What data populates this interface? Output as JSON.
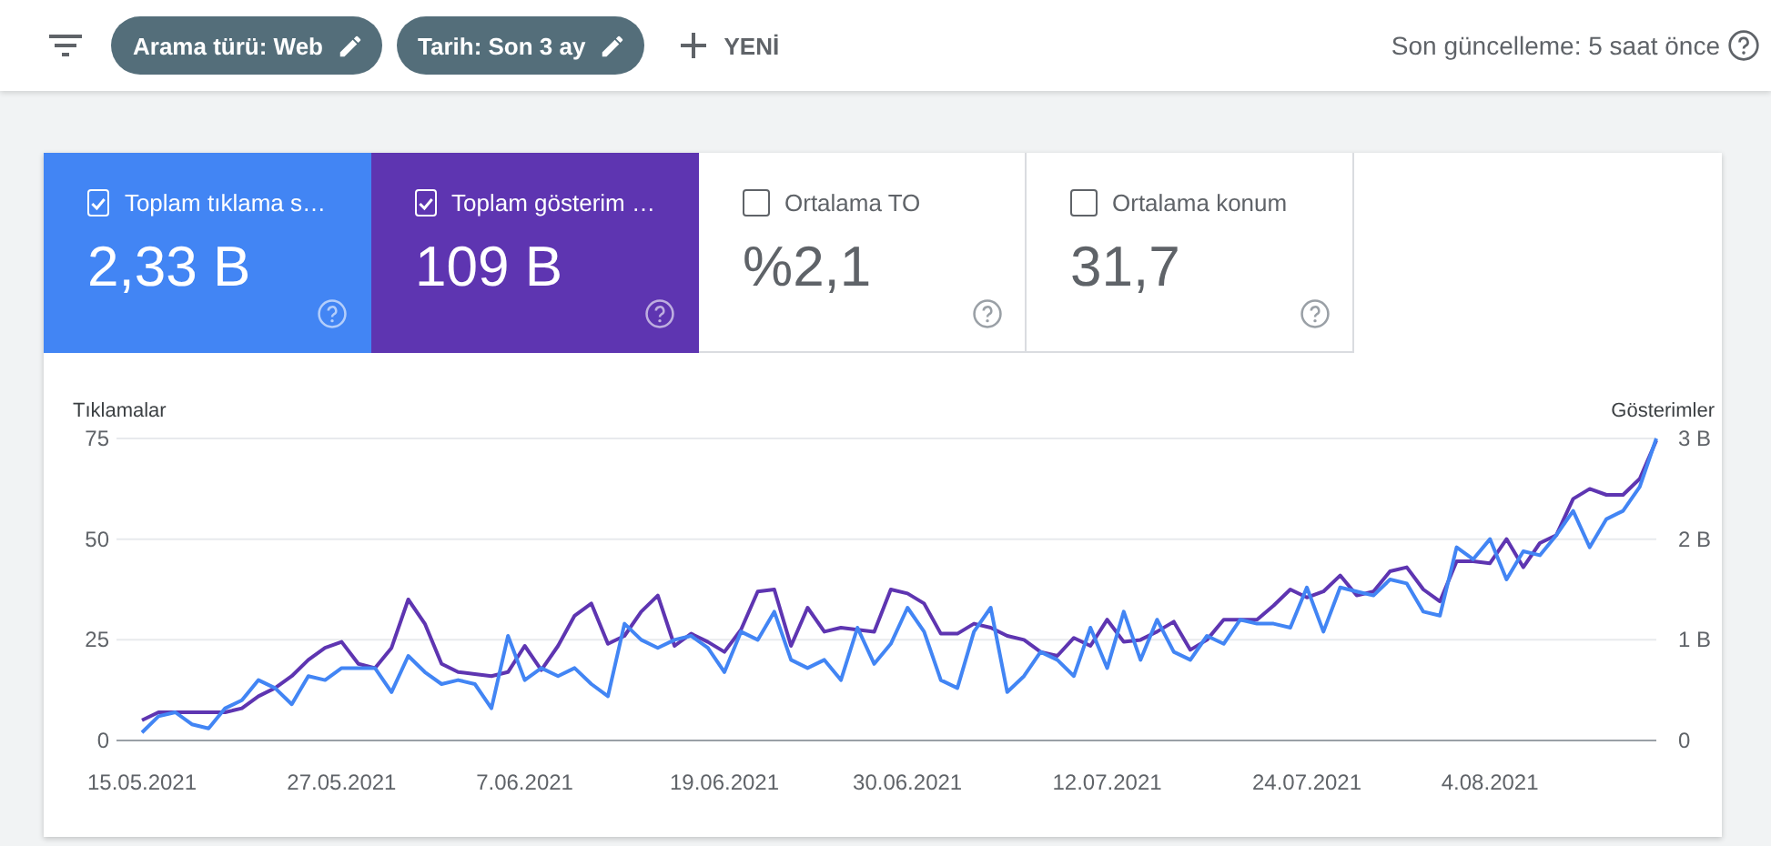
{
  "toolbar": {
    "chips": [
      {
        "label": "Arama türü: Web"
      },
      {
        "label": "Tarih: Son 3 ay"
      }
    ],
    "new_button": "YENİ",
    "last_update": "Son güncelleme: 5 saat önce"
  },
  "metrics": [
    {
      "title": "Toplam tıklama s…",
      "value": "2,33 B",
      "selected": true,
      "color": "#4285f4"
    },
    {
      "title": "Toplam gösterim …",
      "value": "109 B",
      "selected": true,
      "color": "#5e35b1"
    },
    {
      "title": "Ortalama TO",
      "value": "%2,1",
      "selected": false
    },
    {
      "title": "Ortalama konum",
      "value": "31,7",
      "selected": false
    }
  ],
  "chart_data": {
    "type": "line",
    "ylabel": "Tıklamalar",
    "y2label": "Gösterimler",
    "categories": [
      "15.05.2021",
      null,
      null,
      null,
      null,
      null,
      null,
      null,
      null,
      null,
      null,
      null,
      "27.05.2021",
      null,
      null,
      null,
      null,
      null,
      null,
      null,
      null,
      null,
      null,
      "7.06.2021",
      null,
      null,
      null,
      null,
      null,
      null,
      null,
      null,
      null,
      null,
      null,
      "19.06.2021",
      null,
      null,
      null,
      null,
      null,
      null,
      null,
      null,
      null,
      null,
      "30.06.2021",
      null,
      null,
      null,
      null,
      null,
      null,
      null,
      null,
      null,
      null,
      null,
      "12.07.2021",
      null,
      null,
      null,
      null,
      null,
      null,
      null,
      null,
      null,
      null,
      null,
      "24.07.2021",
      null,
      null,
      null,
      null,
      null,
      null,
      null,
      null,
      null,
      null,
      "4.08.2021",
      null,
      null,
      null,
      null,
      null,
      null,
      null,
      null,
      null,
      null
    ],
    "ylim": [
      0,
      75
    ],
    "y2lim": [
      0,
      3
    ],
    "yticks": [
      0,
      25,
      50,
      75
    ],
    "y2ticks": [
      {
        "value": 0,
        "label": "0"
      },
      {
        "value": 1,
        "label": "1 B"
      },
      {
        "value": 2,
        "label": "2 B"
      },
      {
        "value": 3,
        "label": "3 B"
      }
    ],
    "series": [
      {
        "color": "#5e35b1",
        "axis": "y2",
        "values": [
          0.2,
          0.28,
          0.28,
          0.28,
          0.28,
          0.28,
          0.32,
          0.44,
          0.52,
          0.64,
          0.8,
          0.92,
          0.98,
          0.76,
          0.72,
          0.92,
          1.4,
          1.16,
          0.76,
          0.68,
          0.66,
          0.64,
          0.68,
          0.94,
          0.7,
          0.94,
          1.24,
          1.36,
          0.96,
          1.04,
          1.28,
          1.44,
          0.94,
          1.06,
          0.98,
          0.88,
          1.1,
          1.48,
          1.5,
          0.94,
          1.32,
          1.08,
          1.12,
          1.1,
          1.08,
          1.5,
          1.46,
          1.36,
          1.06,
          1.06,
          1.16,
          1.12,
          1.04,
          1,
          0.88,
          0.84,
          1.02,
          0.94,
          1.2,
          0.98,
          1,
          1.08,
          1.18,
          0.9,
          1,
          1.2,
          1.2,
          1.2,
          1.34,
          1.5,
          1.42,
          1.48,
          1.64,
          1.44,
          1.48,
          1.68,
          1.72,
          1.5,
          1.38,
          1.78,
          1.78,
          1.76,
          2,
          1.72,
          1.96,
          2.04,
          2.4,
          2.5,
          2.44,
          2.44,
          2.6,
          2.98
        ]
      },
      {
        "color": "#4285f4",
        "values": [
          2,
          6,
          7,
          4,
          3,
          8,
          10,
          15,
          13,
          9,
          16,
          15,
          18,
          18,
          18,
          12,
          21,
          17,
          14,
          15,
          14,
          8,
          26,
          15,
          18,
          16,
          18,
          14,
          11,
          29,
          25,
          23,
          25,
          26,
          23,
          17,
          27,
          25,
          32,
          20,
          18,
          20,
          15,
          28,
          19,
          24,
          33,
          27,
          15,
          13,
          27,
          33,
          12,
          16,
          22,
          20,
          16,
          28,
          18,
          32,
          20,
          30,
          22,
          20,
          26,
          24,
          30,
          29,
          29,
          28,
          38,
          27,
          38,
          37,
          36,
          40,
          39,
          32,
          31,
          48,
          45,
          50,
          40,
          47,
          46,
          51,
          57,
          48,
          55,
          57,
          63,
          75
        ]
      }
    ]
  }
}
